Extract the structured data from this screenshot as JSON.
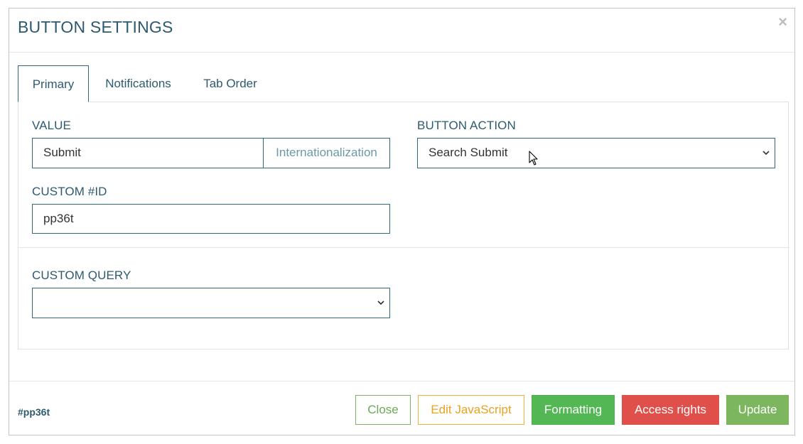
{
  "dialog": {
    "title": "BUTTON SETTINGS",
    "close_symbol": "×"
  },
  "tabs": [
    {
      "label": "Primary",
      "active": true
    },
    {
      "label": "Notifications",
      "active": false
    },
    {
      "label": "Tab Order",
      "active": false
    }
  ],
  "form": {
    "value_label": "VALUE",
    "value": "Submit",
    "internationalization_label": "Internationalization",
    "button_action_label": "BUTTON ACTION",
    "button_action_selected": "Search Submit",
    "custom_id_label": "CUSTOM #ID",
    "custom_id": "pp36t",
    "custom_query_label": "CUSTOM QUERY",
    "custom_query_selected": ""
  },
  "footer": {
    "element_id": "#pp36t",
    "buttons": {
      "close": "Close",
      "edit_js": "Edit JavaScript",
      "formatting": "Formatting",
      "access_rights": "Access rights",
      "update": "Update"
    }
  },
  "icons": {
    "close": "close-icon",
    "select_chevron": "chevron-down-icon",
    "cursor": "mouse-pointer-icon"
  },
  "colors": {
    "primary": "#2d6a80",
    "close_btn": "#6aa957",
    "edit_js_btn": "#eaa21f",
    "formatting_btn": "#53b753",
    "access_rights_btn": "#df504b",
    "update_btn": "#7cb65e"
  }
}
